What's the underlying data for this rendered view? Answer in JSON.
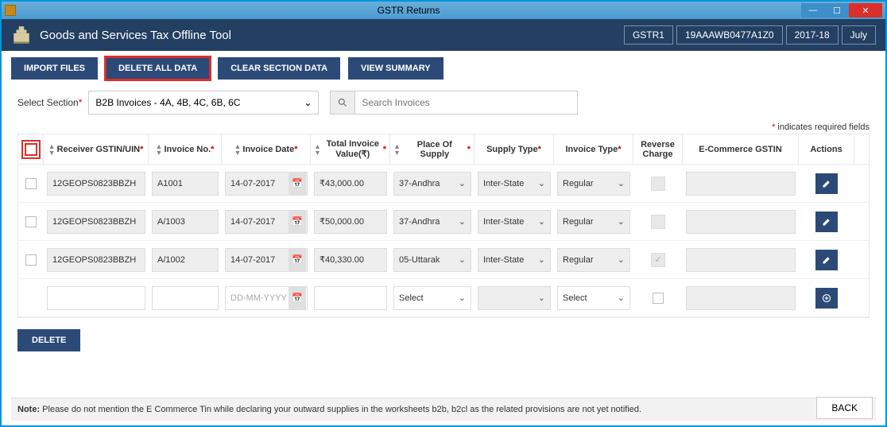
{
  "window": {
    "title": "GSTR Returns"
  },
  "app": {
    "title": "Goods and Services Tax Offline Tool",
    "chips": {
      "return": "GSTR1",
      "gstin": "19AAAWB0477A1Z0",
      "fy": "2017-18",
      "period": "July"
    }
  },
  "toolbar": {
    "import": "IMPORT FILES",
    "delete_all": "DELETE ALL DATA",
    "clear_section": "CLEAR SECTION DATA",
    "view_summary": "VIEW SUMMARY"
  },
  "section": {
    "label": "Select Section",
    "selected": "B2B Invoices - 4A, 4B, 4C, 6B, 6C",
    "search_placeholder": "Search Invoices"
  },
  "required_note": "indicates required fields",
  "columns": {
    "gstin": "Receiver GSTIN/UIN",
    "invno": "Invoice No.",
    "invdate": "Invoice Date",
    "total": "Total Invoice Value(₹)",
    "pos": "Place Of Supply",
    "stype": "Supply Type",
    "itype": "Invoice Type",
    "rev": "Reverse Charge",
    "ecom": "E-Commerce GSTIN",
    "actions": "Actions"
  },
  "rows": [
    {
      "gstin": "12GEOPS0823BBZH",
      "invno": "A1001",
      "invdate": "14-07-2017",
      "total": "₹43,000.00",
      "pos": "37-Andhra",
      "stype": "Inter-State",
      "itype": "Regular",
      "rev": false,
      "ecom": ""
    },
    {
      "gstin": "12GEOPS0823BBZH",
      "invno": "A/1003",
      "invdate": "14-07-2017",
      "total": "₹50,000.00",
      "pos": "37-Andhra",
      "stype": "Inter-State",
      "itype": "Regular",
      "rev": false,
      "ecom": ""
    },
    {
      "gstin": "12GEOPS0823BBZH",
      "invno": "A/1002",
      "invdate": "14-07-2017",
      "total": "₹40,330.00",
      "pos": "05-Uttarak",
      "stype": "Inter-State",
      "itype": "Regular",
      "rev": true,
      "ecom": ""
    }
  ],
  "new_row": {
    "date_placeholder": "DD-MM-YYYY",
    "select_placeholder": "Select"
  },
  "buttons": {
    "delete": "DELETE",
    "back": "BACK"
  },
  "footer": {
    "label": "Note:",
    "text": " Please do not mention the E Commerce Tin while declaring your outward supplies in the worksheets b2b, b2cl as the related provisions are not yet notified."
  }
}
